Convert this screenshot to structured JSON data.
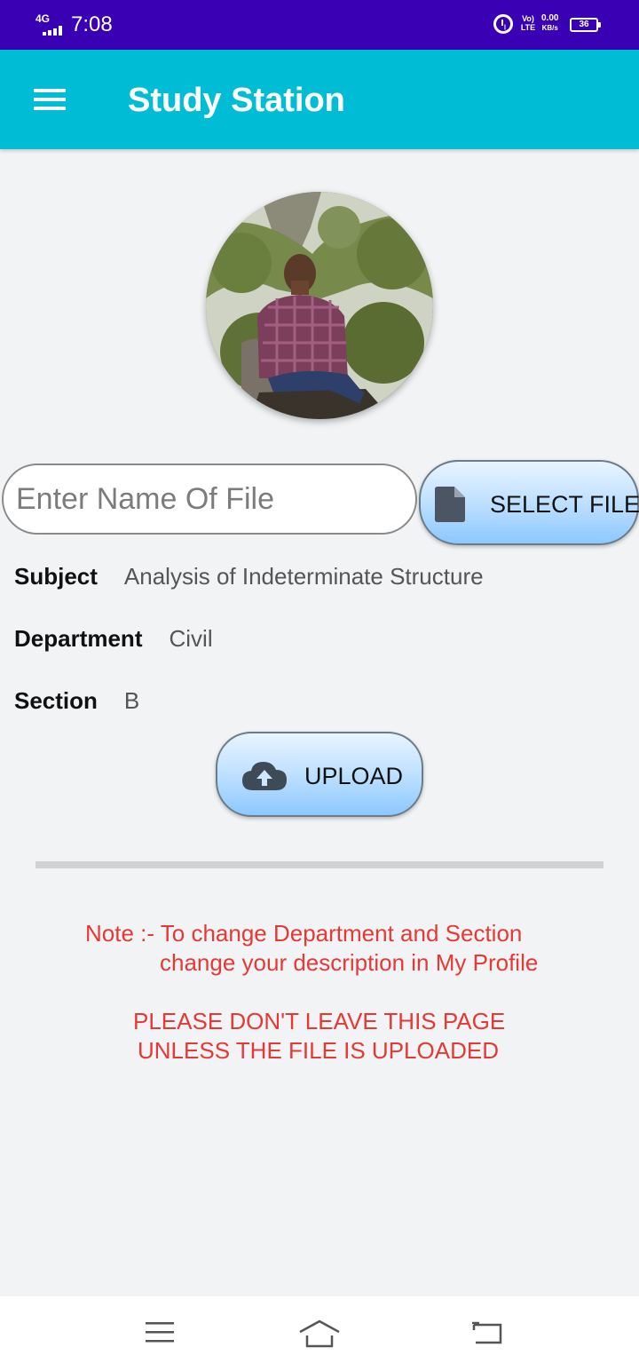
{
  "status_bar": {
    "network": "4G",
    "time": "7:08",
    "volte": "Vo) LTE",
    "speed_value": "0.00",
    "speed_unit": "KB/s",
    "battery": "36"
  },
  "app_bar": {
    "title": "Study Station",
    "menu_icon": "hamburger-menu-icon"
  },
  "upload_form": {
    "file_name_placeholder": "Enter Name Of File",
    "file_name_value": "",
    "select_file_label": "SELECT FILE",
    "select_file_icon": "file-icon",
    "subject_label": "Subject",
    "subject_value": "Analysis of Indeterminate Structure",
    "department_label": "Department",
    "department_value": "Civil",
    "section_label": "Section",
    "section_value": "B",
    "upload_label": "UPLOAD",
    "upload_icon": "cloud-upload-icon"
  },
  "notes": {
    "line1": "Note :- To change Department and Section",
    "line2": "change your description in My Profile",
    "warning1": "PLEASE DON'T LEAVE THIS PAGE",
    "warning2": "UNLESS THE FILE IS UPLOADED"
  },
  "nav_bar": {
    "icons": [
      "recent-apps-icon",
      "home-icon",
      "back-icon"
    ]
  },
  "colors": {
    "status_bar": "#3a00b4",
    "app_bar": "#00bcd4",
    "note_text": "#e53935",
    "background": "#f2f3f5"
  }
}
